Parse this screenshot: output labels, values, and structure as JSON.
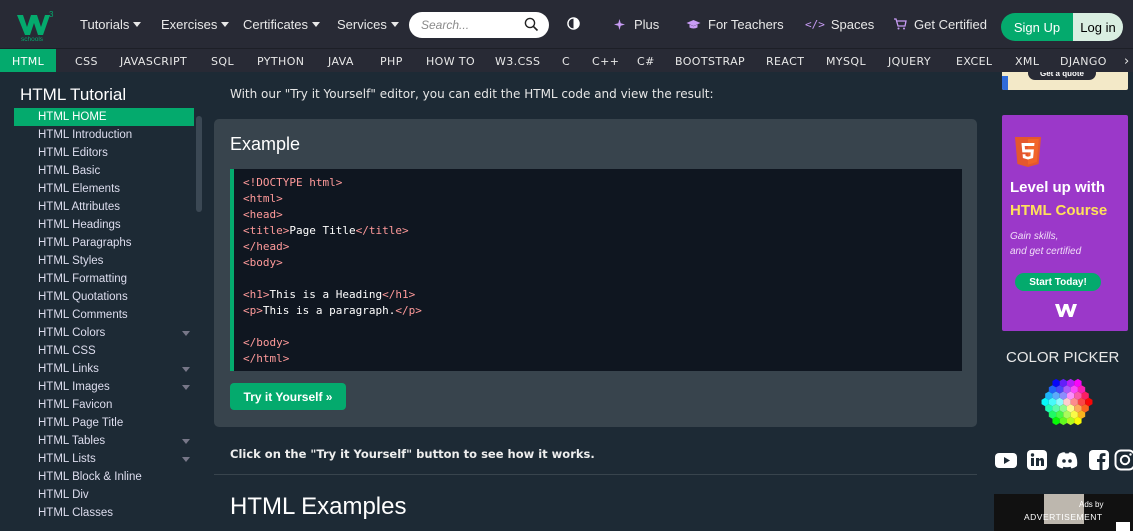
{
  "nav": {
    "logo_label": "schools",
    "menus": [
      "Tutorials",
      "Exercises",
      "Certificates",
      "Services"
    ],
    "search_placeholder": "Search...",
    "plus": "Plus",
    "for_teachers": "For Teachers",
    "spaces": "Spaces",
    "get_certified": "Get Certified",
    "sign_up": "Sign Up",
    "log_in": "Log in"
  },
  "subnav": [
    "HTML",
    "CSS",
    "JAVASCRIPT",
    "SQL",
    "PYTHON",
    "JAVA",
    "PHP",
    "HOW TO",
    "W3.CSS",
    "C",
    "C++",
    "C#",
    "BOOTSTRAP",
    "REACT",
    "MYSQL",
    "JQUERY",
    "EXCEL",
    "XML",
    "DJANGO"
  ],
  "sidebar": {
    "title": "HTML Tutorial",
    "items": [
      "HTML HOME",
      "HTML Introduction",
      "HTML Editors",
      "HTML Basic",
      "HTML Elements",
      "HTML Attributes",
      "HTML Headings",
      "HTML Paragraphs",
      "HTML Styles",
      "HTML Formatting",
      "HTML Quotations",
      "HTML Comments",
      "HTML Colors",
      "HTML CSS",
      "HTML Links",
      "HTML Images",
      "HTML Favicon",
      "HTML Page Title",
      "HTML Tables",
      "HTML Lists",
      "HTML Block & Inline",
      "HTML Div",
      "HTML Classes"
    ]
  },
  "main": {
    "intro": "With our \"Try it Yourself\" editor, you can edit the HTML code and view the result:",
    "example_title": "Example",
    "code": [
      {
        "tag": "<!DOCTYPE html>",
        "text": ""
      },
      {
        "tag": "<html>",
        "text": ""
      },
      {
        "tag": "<head>",
        "text": ""
      },
      {
        "tag": "<title>",
        "text": "Page Title",
        "close": "</title>"
      },
      {
        "tag": "</head>",
        "text": ""
      },
      {
        "tag": "<body>",
        "text": ""
      },
      {
        "tag": "",
        "text": ""
      },
      {
        "tag": "<h1>",
        "text": "This is a Heading",
        "close": "</h1>"
      },
      {
        "tag": "<p>",
        "text": "This is a paragraph.",
        "close": "</p>"
      },
      {
        "tag": "",
        "text": ""
      },
      {
        "tag": "</body>",
        "text": ""
      },
      {
        "tag": "</html>",
        "text": ""
      }
    ],
    "try_button": "Try it Yourself »",
    "click_text": "Click on the \"Try it Yourself\" button to see how it works.",
    "section_title": "HTML Examples"
  },
  "right": {
    "top_ad_button": "Get a quote",
    "promo_line1": "Level up with",
    "promo_line2": "HTML Course",
    "promo_sub1": "Gain skills,",
    "promo_sub2": "and get certified",
    "promo_button": "Start Today!",
    "color_picker": "COLOR PICKER",
    "ads_by": "Ads by",
    "advertisement": "ADVERTISEMENT"
  },
  "colors": {
    "brand_green": "#04aa6d",
    "navbar": "#282a35",
    "background": "#1d2a35",
    "code_tag": "#ff9a9a",
    "promo_purple": "#9b38c9"
  }
}
